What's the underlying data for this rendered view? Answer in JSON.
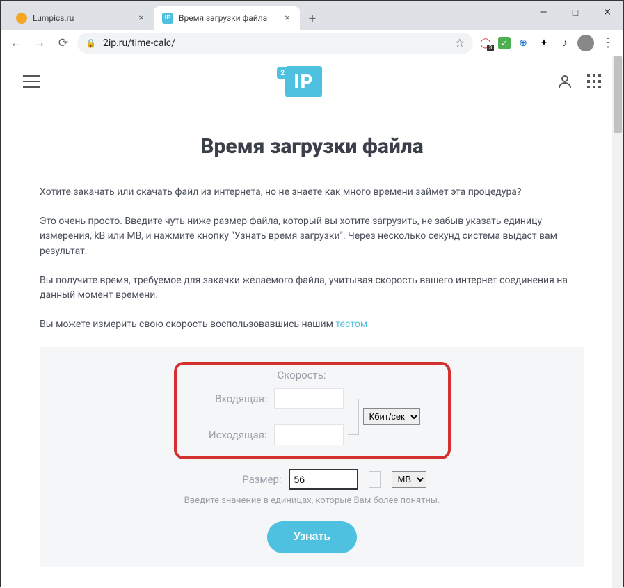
{
  "tabs": [
    {
      "title": "Lumpics.ru"
    },
    {
      "title": "Время загрузки файла"
    }
  ],
  "url": "2ip.ru/time-calc/",
  "logo": {
    "badge": "2",
    "text": "IP"
  },
  "page": {
    "heading": "Время загрузки файла",
    "p1": "Хотите закачать или скачать файл из интернета, но не знаете как много времени займет эта процедура?",
    "p2": "Это очень просто. Введите чуть ниже размер файла, который вы хотите загрузить, не забыв указать единицу измерения, kB или MB, и нажмите кнопку \"Узнать время загрузки\". Через несколько секунд система выдаст вам результат.",
    "p3": "Вы получите время, требуемое для закачки желаемого файла, учитывая скорость вашего интернет соединения на данный момент времени.",
    "p4_prefix": "Вы можете измерить свою скорость воспользовавшись нашим ",
    "p4_link": "тестом"
  },
  "form": {
    "speed_label": "Скорость:",
    "incoming_label": "Входящая:",
    "outgoing_label": "Исходящая:",
    "speed_unit": "Кбит/сек",
    "size_label": "Размер:",
    "size_value": "56",
    "size_unit": "MB",
    "hint": "Введите значение в единицах, которые Вам более понятны.",
    "submit": "Узнать"
  }
}
